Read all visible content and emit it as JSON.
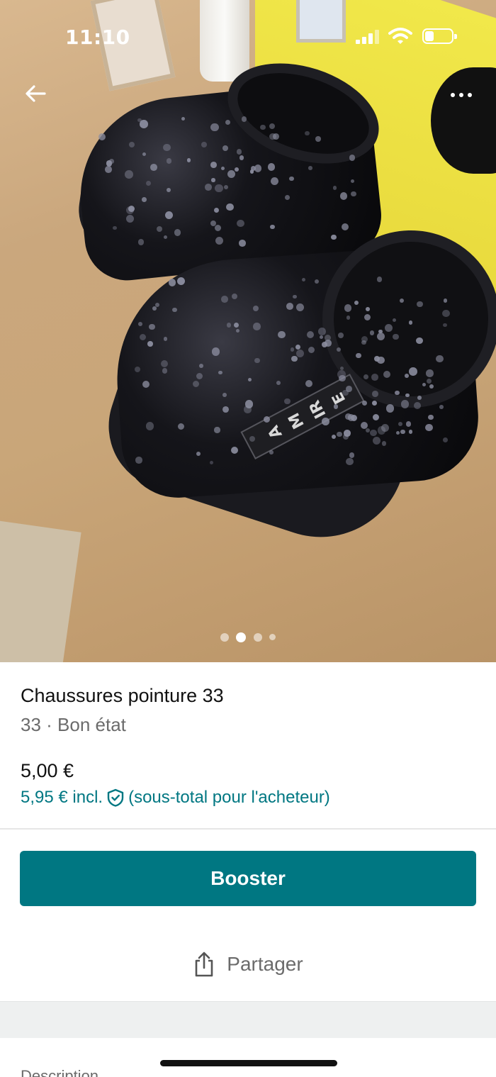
{
  "status_bar": {
    "time": "11:10"
  },
  "navigation": {
    "back_icon": "arrow-left-icon",
    "more_icon": "more-horizontal-icon"
  },
  "gallery": {
    "image_count": 4,
    "active_index": 1,
    "tape_text": "AMIRE"
  },
  "listing": {
    "title": "Chaussures pointure 33",
    "subtitle": "33 · Bon état",
    "price": "5,00 €",
    "price_incl": "5,95 € incl.",
    "buyer_note": "(sous-total pour l'acheteur)"
  },
  "actions": {
    "booster_label": "Booster",
    "share_label": "Partager"
  },
  "description": {
    "heading": "Description"
  },
  "colors": {
    "accent": "#007782",
    "text": "#111111",
    "muted": "#6b6b6b"
  }
}
